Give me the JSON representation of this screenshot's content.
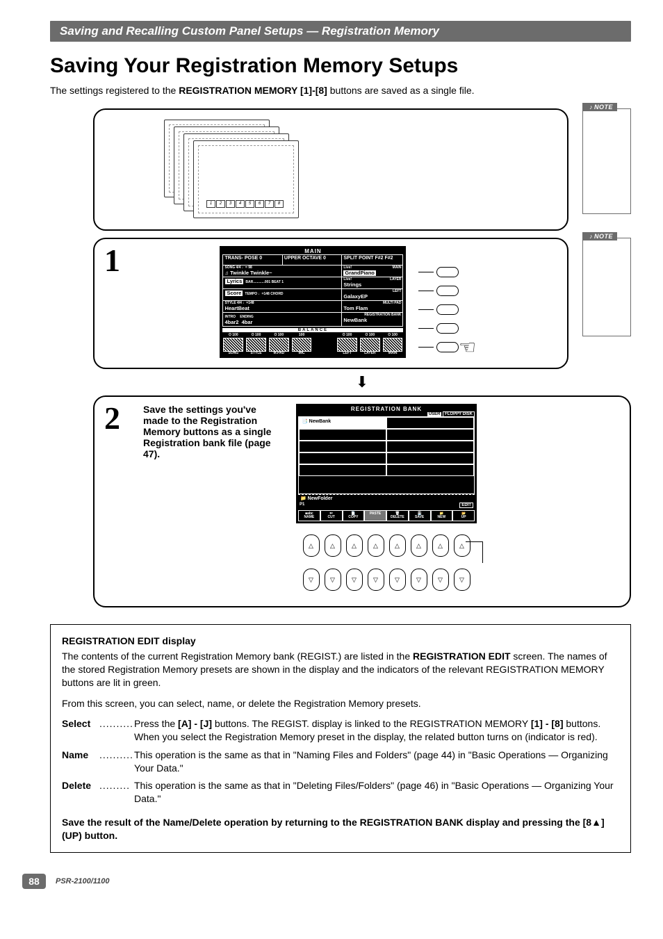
{
  "header_bar": "Saving and Recalling Custom Panel Setups — Registration Memory",
  "main_title": "Saving Your Registration Memory Setups",
  "intro_pre": "The settings registered to the ",
  "intro_bold": "REGISTRATION MEMORY [1]-[8]",
  "intro_post": " buttons are saved as a single file.",
  "note_label": "NOTE",
  "numstrip": [
    "1",
    "2",
    "3",
    "4",
    "5",
    "6",
    "7",
    "8"
  ],
  "step1": {
    "num": "1",
    "lcd_title": "MAIN",
    "top_row": {
      "transpose": "TRANS-\nPOSE 0",
      "octave": "UPPER\nOCTAVE 0",
      "split": "SPLIT\nPOINT  F#2  F#2"
    },
    "song_row": {
      "left_small": "SONG    4/4   ♩=  98",
      "left_main": "♫ Twinkle Twinkle~",
      "right_tag": "Live!",
      "right_label": "MAIN",
      "right_inv": "GrandPiano"
    },
    "lyrics_row": {
      "btn": "Lyrics",
      "mid": "BAR............001\nBEAT             1",
      "right_tag": "Live!",
      "right_label": "LAYER",
      "right_inv": "Strings"
    },
    "score_row": {
      "btn": "Score",
      "mid": "TEMPO    ♩=148\nCHORD",
      "right_label": "LEFT",
      "right_inv": "GalaxyEP"
    },
    "style_row": {
      "left_small": "STYLE   4/4   ♩=148",
      "left_main": "HeartBeat",
      "right_label": "MULTI PAD",
      "right_main": "Tom Flam"
    },
    "intro_row": {
      "l1": "INTRO",
      "l2": "ENDING",
      "l1b": "4bar2",
      "l2b": "4bar",
      "right_label": "REGISTRATION BANK",
      "right_main": "NewBank"
    },
    "balance_label": "BALANCE",
    "slider_vals": [
      "O 100",
      "O 100",
      "O 100",
      "100",
      "",
      "O 100",
      "O 100",
      "O 100"
    ],
    "slider_names": [
      "SONG",
      "STYLE",
      "M.PAD",
      "MIC",
      "",
      "LEFT",
      "LAYER",
      "MAIN"
    ]
  },
  "step2": {
    "num": "2",
    "text": "Save the settings you've made to the Registration Memory buttons as a single Registration bank file (page 47).",
    "lcd_title": "REGISTRATION BANK",
    "tab_user": "USER",
    "tab_fd": "FLOPPY DISK",
    "bank_entry": "NewBank",
    "folder_entry": "NewFolder",
    "p1": "P1",
    "edit_tag": "EDIT",
    "toolbar": [
      "NAME",
      "CUT",
      "COPY",
      "PASTE",
      "DELETE",
      "SAVE",
      "NEW",
      "UP"
    ],
    "toolbar_pre": [
      "■abc",
      "✄",
      "📄",
      "",
      "🗑",
      "💾",
      "📁",
      "📂"
    ]
  },
  "info": {
    "title": "REGISTRATION EDIT display",
    "para1_pre": "The contents of the current Registration Memory bank (REGIST.) are listed in the ",
    "para1_bold": "REGISTRATION EDIT",
    "para1_post": " screen. The names of the stored Registration Memory presets are shown in the display and the indicators of the relevant REGISTRATION MEMORY buttons are lit in green.",
    "para2": "From this screen, you can select, name, or delete the Registration Memory presets.",
    "select_label": "Select",
    "select_body_pre": "Press the ",
    "select_b1": "[A] - [J]",
    "select_mid": " buttons. The REGIST. display is linked to the REGISTRATION MEMORY ",
    "select_b2": "[1] - [8]",
    "select_body_post": " buttons. When you select the Registration Memory preset in the display, the related button turns on (indicator is red).",
    "name_label": "Name",
    "name_body": "This operation is the same as that in \"Naming Files and Folders\" (page 44) in \"Basic Operations — Organizing Your Data.\"",
    "delete_label": "Delete",
    "delete_body": "This operation is the same as that in \"Deleting Files/Folders\" (page 46) in \"Basic Operations — Organizing Your Data.\"",
    "save_note": "Save the result of the Name/Delete operation by returning to the REGISTRATION BANK display and pressing the [8▲] (UP) button."
  },
  "footer": {
    "page": "88",
    "model": "PSR-2100/1100"
  }
}
